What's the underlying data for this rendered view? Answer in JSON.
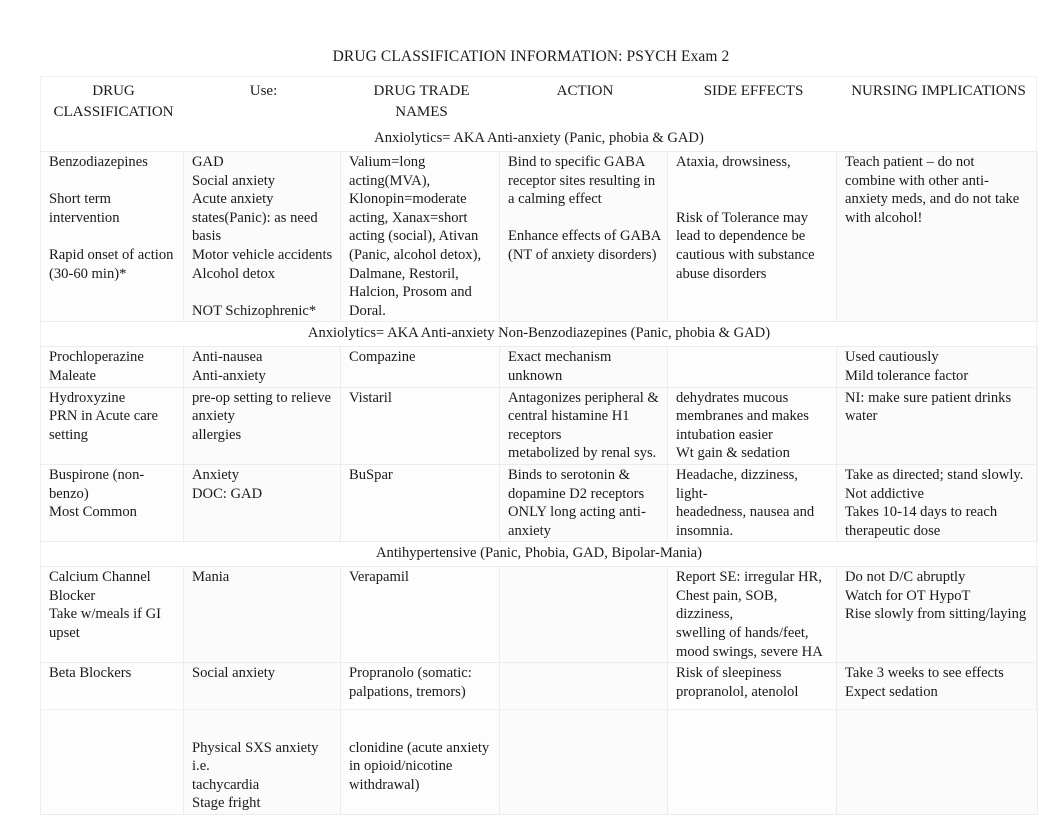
{
  "document": {
    "title": "DRUG CLASSIFICATION INFORMATION: PSYCH Exam 2"
  },
  "table": {
    "columns": [
      "DRUG CLASSIFICATION",
      "Use:",
      "DRUG TRADE NAMES",
      "ACTION",
      "SIDE EFFECTS",
      "NURSING IMPLICATIONS"
    ],
    "sections": [
      {
        "banner": "Anxiolytics= AKA Anti-anxiety (Panic, phobia & GAD)",
        "banner_color": "#eec5a6",
        "rows": [
          {
            "classification": "Benzodiazepines\n\nShort term\nintervention\n\nRapid onset of action\n(30-60 min)*",
            "use": "GAD\nSocial anxiety\nAcute anxiety\nstates(Panic): as need\nbasis\nMotor vehicle accidents\nAlcohol detox\n\nNOT Schizophrenic*",
            "trade_names": "Valium=long\nacting(MVA),\nKlonopin=moderate\nacting, Xanax=short\nacting (social), Ativan\n(Panic, alcohol detox),\nDalmane, Restoril,\nHalcion, Prosom and\nDoral.",
            "action": "Bind to specific GABA\nreceptor sites resulting in\na calming effect\n\nEnhance effects of GABA\n(NT of anxiety disorders)",
            "side_effects": "Ataxia, drowsiness,\n\n\nRisk of Tolerance  may\nlead to dependence be\ncautious with substance\nabuse disorders",
            "nursing": "Teach patient – do not\ncombine with other anti-\nanxiety meds, and do not take\nwith alcohol!"
          }
        ]
      },
      {
        "banner": "Anxiolytics= AKA Anti-anxiety Non-Benzodiazepines (Panic, phobia & GAD)",
        "banner_color": "#e8b923",
        "rows": [
          {
            "classification": "Prochloperazine\nMaleate",
            "use": "Anti-nausea\nAnti-anxiety",
            "trade_names": "Compazine",
            "action": "Exact mechanism\nunknown",
            "side_effects": "",
            "nursing": "Used cautiously\nMild tolerance factor"
          },
          {
            "classification": "Hydroxyzine\nPRN in Acute care\nsetting",
            "use": "pre-op setting to relieve\nanxiety\nallergies",
            "trade_names": "Vistaril",
            "action": "Antagonizes peripheral &\ncentral histamine H1\nreceptors\nmetabolized by renal sys.",
            "side_effects": "dehydrates mucous\nmembranes and makes\nintubation easier\nWt gain & sedation",
            "nursing": "NI: make sure patient drinks\nwater"
          },
          {
            "classification": "Buspirone (non-\nbenzo)\nMost Common",
            "use": "Anxiety\nDOC: GAD",
            "trade_names": "BuSpar",
            "action": "Binds to serotonin &\ndopamine D2 receptors\nONLY long acting anti-\nanxiety",
            "side_effects": "Headache, dizziness, light-\nheadedness, nausea and\ninsomnia.",
            "nursing": "Take as directed; stand slowly.\nNot addictive\nTakes 10-14 days to reach\ntherapeutic dose"
          }
        ]
      },
      {
        "banner": "Antihypertensive (Panic, Phobia, GAD, Bipolar-Mania)",
        "banner_color": "#e8b923",
        "rows": [
          {
            "classification": "Calcium Channel\nBlocker\nTake w/meals if GI\nupset",
            "use": "Mania",
            "trade_names": "Verapamil",
            "action": "",
            "side_effects": "Report SE: irregular HR,\nChest pain, SOB, dizziness,\nswelling of hands/feet,\nmood swings, severe HA",
            "nursing": "Do not D/C abruptly\nWatch for OT HypoT\nRise slowly from sitting/laying"
          },
          {
            "classification": "Beta Blockers",
            "use": "Social anxiety\n\n\n\nPhysical SXS anxiety i.e.\ntachycardia\nStage fright",
            "trade_names": "Propranolo (somatic:\npalpations, tremors)\n\n\nclonidine (acute anxiety\nin opioid/nicotine\nwithdrawal)",
            "action": "",
            "side_effects": "Risk of sleepiness\npropranolol, atenolol",
            "nursing": "Take 3 weeks to see effects\nExpect sedation"
          }
        ]
      }
    ]
  }
}
